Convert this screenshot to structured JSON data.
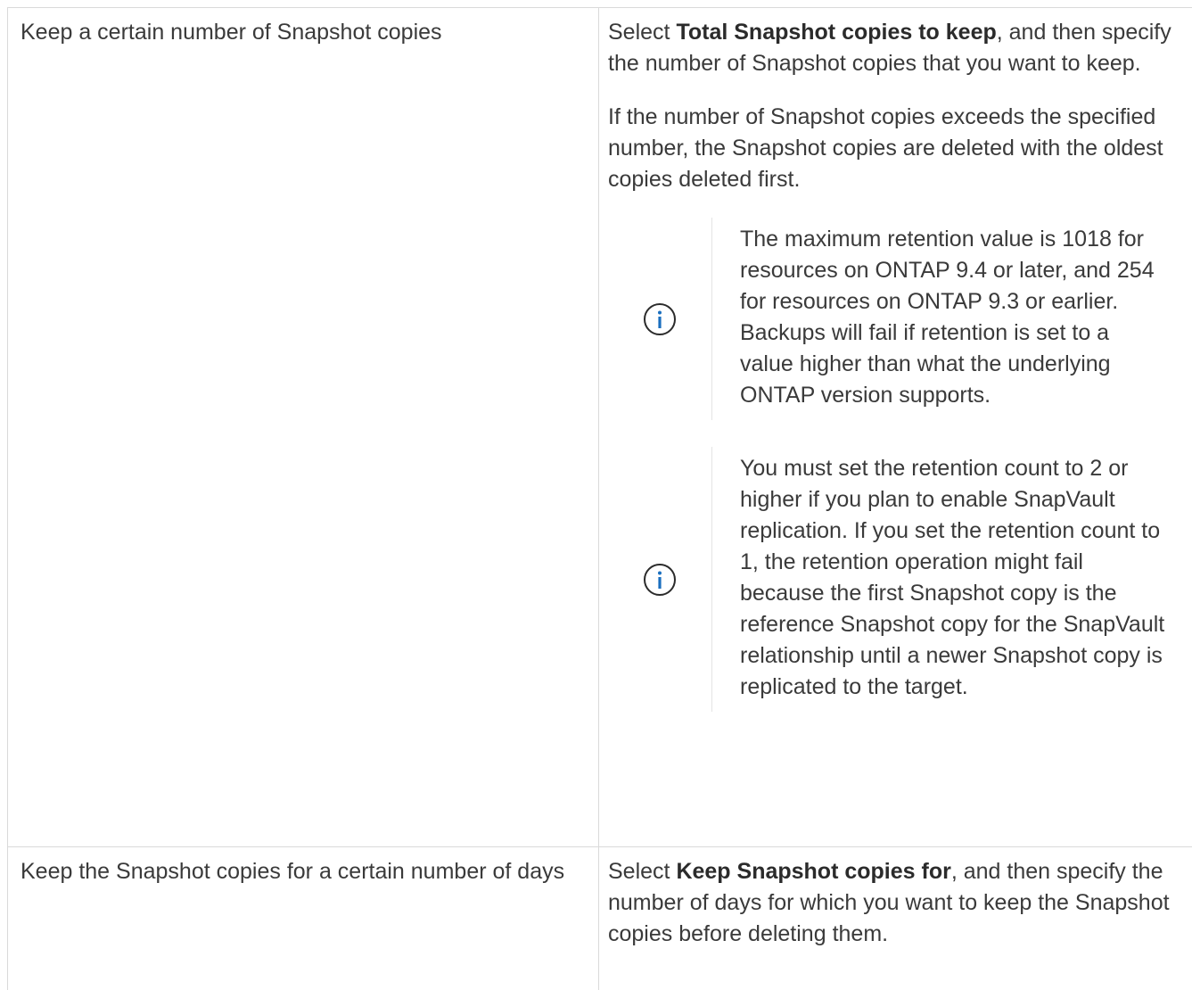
{
  "rows": [
    {
      "left": "Keep a certain number of Snapshot copies",
      "right": {
        "intro_prefix": "Select ",
        "intro_bold": "Total Snapshot copies to keep",
        "intro_suffix": ", and then specify the number of Snapshot copies that you want to keep.",
        "paragraph": "If the number of Snapshot copies exceeds the specified number, the Snapshot copies are deleted with the oldest copies deleted first.",
        "notes": [
          {
            "icon": "info-icon",
            "text": "The maximum retention value is 1018 for resources on ONTAP 9.4 or later, and 254 for resources on ONTAP 9.3 or earlier. Backups will fail if retention is set to a value higher than what the underlying ONTAP version supports."
          },
          {
            "icon": "info-icon",
            "text": "You must set the retention count to 2 or higher if you plan to enable SnapVault replication. If you set the retention count to 1, the retention operation might fail because the first Snapshot copy is the reference Snapshot copy for the SnapVault relationship until a newer Snapshot copy is replicated to the target."
          }
        ]
      }
    },
    {
      "left": "Keep the Snapshot copies for a certain number of days",
      "right": {
        "intro_prefix": "Select ",
        "intro_bold": "Keep Snapshot copies for",
        "intro_suffix": ", and then specify the number of days for which you want to keep the Snapshot copies before deleting them."
      }
    }
  ],
  "colors": {
    "text": "#3a3a3a",
    "border": "#dadada",
    "icon": "#1a6fbf"
  }
}
